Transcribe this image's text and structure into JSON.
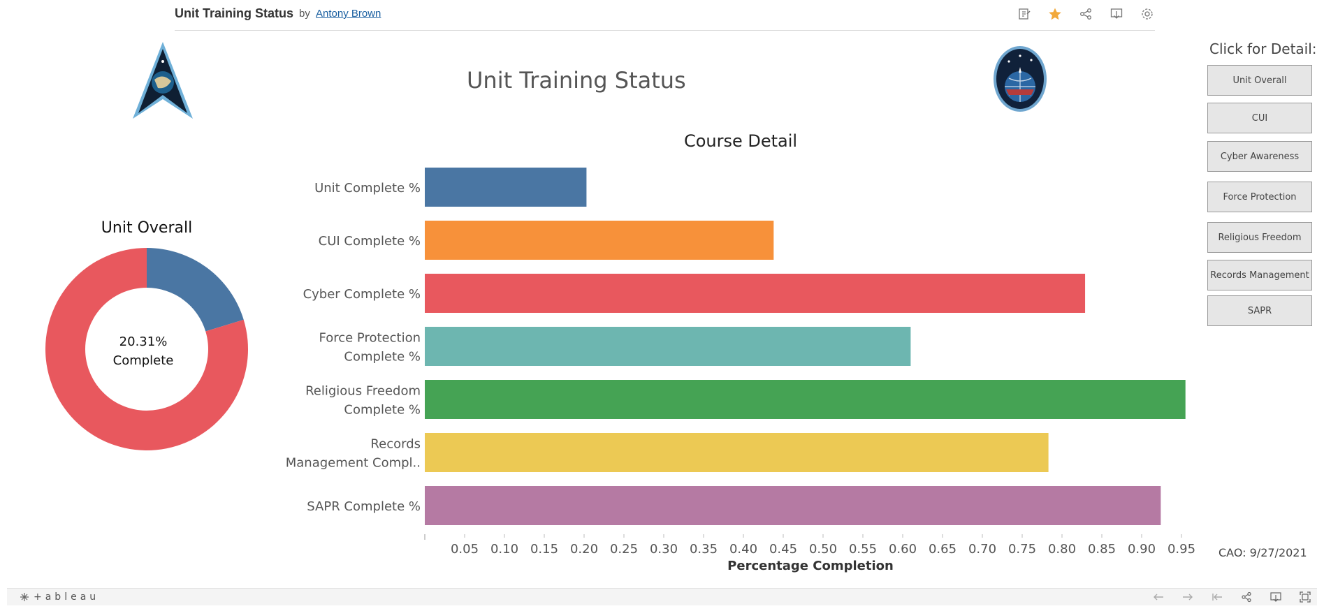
{
  "header": {
    "title": "Unit Training Status",
    "by": "by",
    "author": "Antony Brown",
    "icons": [
      "edit-icon",
      "favorite-star-icon",
      "share-icon",
      "download-icon",
      "settings-gear-icon"
    ]
  },
  "dashboard": {
    "title": "Unit Training Status"
  },
  "donut": {
    "title": "Unit Overall",
    "percent_text": "20.31%",
    "complete_text": "Complete",
    "complete_fraction": 0.2031,
    "colors": {
      "complete": "#4a76a3",
      "incomplete": "#e8585e"
    }
  },
  "chart_data": {
    "type": "bar",
    "orientation": "horizontal",
    "title": "Course Detail",
    "xlabel": "Percentage Completion",
    "ylabel": "",
    "categories": [
      [
        "Unit Complete %"
      ],
      [
        "CUI Complete %"
      ],
      [
        "Cyber Complete %"
      ],
      [
        "Force Protection",
        "Complete %"
      ],
      [
        "Religious Freedom",
        "Complete %"
      ],
      [
        "Records",
        "Management Compl.."
      ],
      [
        "SAPR Complete %"
      ]
    ],
    "values": [
      0.203,
      0.438,
      0.829,
      0.61,
      0.955,
      0.783,
      0.924
    ],
    "colors": [
      "#4a76a3",
      "#f7913a",
      "#e8585e",
      "#6db6b0",
      "#45a354",
      "#ecc954",
      "#b57aa3"
    ],
    "xlim": [
      0,
      1.0
    ],
    "ticks": [
      "0.05",
      "0.10",
      "0.15",
      "0.20",
      "0.25",
      "0.30",
      "0.35",
      "0.40",
      "0.45",
      "0.50",
      "0.55",
      "0.60",
      "0.65",
      "0.70",
      "0.75",
      "0.80",
      "0.85",
      "0.90",
      "0.95"
    ],
    "grid": false
  },
  "detail_panel": {
    "heading": "Click for Detail:",
    "buttons": [
      "Unit Overall",
      "CUI",
      "Cyber Awareness",
      "Force Protection",
      "Religious Freedom",
      "Records Management",
      "SAPR"
    ]
  },
  "footer": {
    "cao": "CAO: 9/27/2021",
    "brand": "+ableau",
    "icons": [
      "undo-icon",
      "redo-icon",
      "revert-icon",
      "share-icon",
      "download-icon",
      "fullscreen-icon"
    ]
  }
}
